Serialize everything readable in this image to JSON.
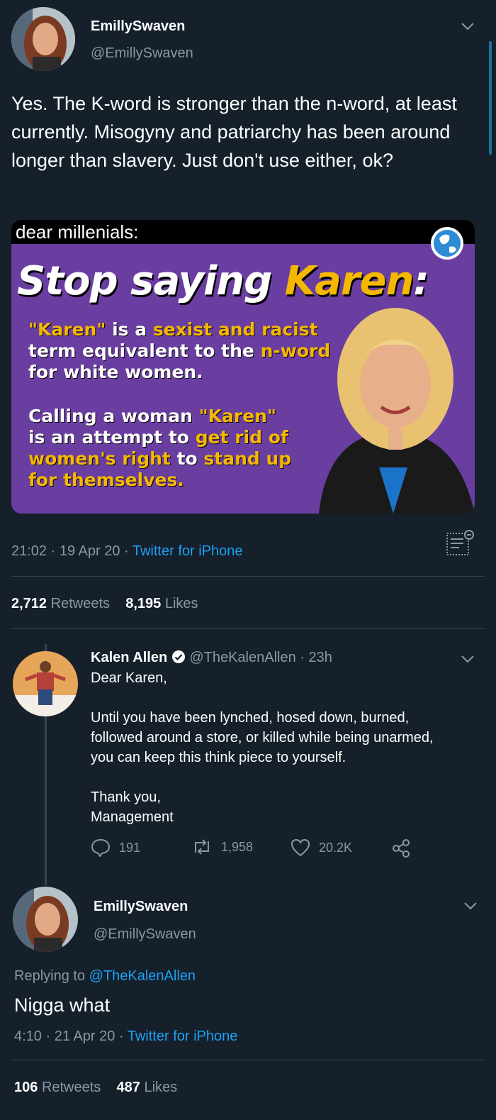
{
  "tweet1": {
    "display_name": "EmillySwaven",
    "handle": "@EmillySwaven",
    "text": "Yes. The K-word is stronger than the n-word, at least currently. Misogyny and patriarchy has been around longer than slavery. Just don't use either, ok?",
    "image": {
      "top_text": "dear millenials:",
      "headline_a": "Stop saying ",
      "headline_b": "Karen",
      "headline_c": ":",
      "body1_lines": [
        [
          "\"Karen\"",
          " is a ",
          "sexist and racist"
        ],
        [
          "term equivalent to the ",
          "n-word"
        ],
        [
          "for white women."
        ]
      ],
      "body2_lines": [
        [
          "Calling a woman ",
          "\"Karen\""
        ],
        [
          "is an attempt to ",
          "get rid of"
        ],
        [
          "women's right",
          " to ",
          "stand up"
        ],
        [
          "for themselves."
        ]
      ]
    },
    "time": "21:02 · 19 Apr 20 · ",
    "source": "Twitter for iPhone",
    "retweets_count": "2,712",
    "retweets_label": "Retweets",
    "likes_count": "8,195",
    "likes_label": "Likes"
  },
  "reply": {
    "display_name": "Kalen Allen",
    "handle_time": "@TheKalenAllen · 23h",
    "lines": [
      "Dear Karen,",
      "",
      "Until you have been lynched, hosed down, burned,",
      "followed around a store, or killed while being unarmed,",
      "you can keep this think piece to yourself.",
      "",
      "Thank you,",
      "Management"
    ],
    "reply_count": "191",
    "retweet_count": "1,958",
    "like_count": "20.2K"
  },
  "tweet2": {
    "display_name": "EmillySwaven",
    "handle": "@EmillySwaven",
    "replying_label": "Replying to ",
    "replying_to": "@TheKalenAllen",
    "text": "Nigga what",
    "time": "4:10 · 21 Apr 20 · ",
    "source": "Twitter for iPhone",
    "retweets_count": "106",
    "retweets_label": "Retweets",
    "likes_count": "487",
    "likes_label": "Likes"
  },
  "colors": {
    "background": "#15202b",
    "link": "#1da1f2",
    "muted": "#8899a6",
    "card_purple": "#6a3ea1",
    "card_yellow": "#f5b800"
  }
}
